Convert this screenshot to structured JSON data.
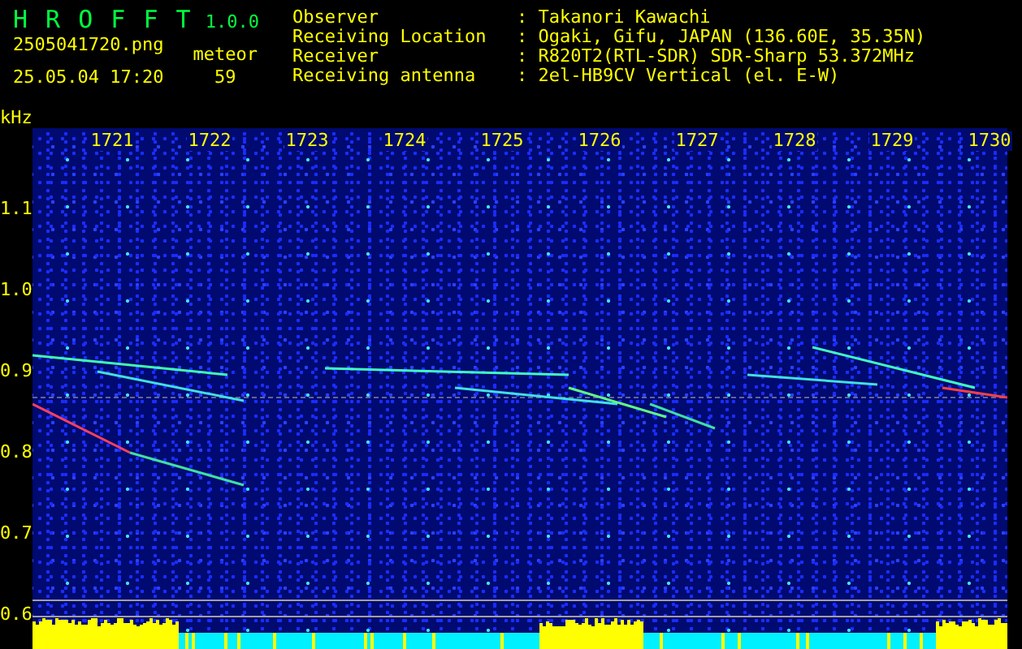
{
  "app": {
    "title": "H R O F F T",
    "version": "1.0.0"
  },
  "capture": {
    "file": "2505041720.png",
    "datetime": "25.05.04 17:20",
    "count_label": "meteor",
    "count": "59"
  },
  "info": [
    {
      "label": "Observer",
      "value": ": Takanori Kawachi"
    },
    {
      "label": "Receiving Location",
      "value": ": Ogaki, Gifu, JAPAN (136.60E, 35.35N)"
    },
    {
      "label": "Receiver",
      "value": ": R820T2(RTL-SDR) SDR-Sharp 53.372MHz"
    },
    {
      "label": "Receiving antenna",
      "value": ": 2el-HB9CV Vertical (el. E-W)"
    }
  ],
  "spectrogram": {
    "unit": "kHz",
    "frequency_labels": [
      "1.1",
      "1.0",
      "0.9",
      "0.8",
      "0.7",
      "0.6"
    ],
    "time_labels": [
      "1721",
      "1722",
      "1723",
      "1724",
      "1725",
      "1726",
      "1727",
      "1728",
      "1729",
      "1730"
    ]
  }
}
